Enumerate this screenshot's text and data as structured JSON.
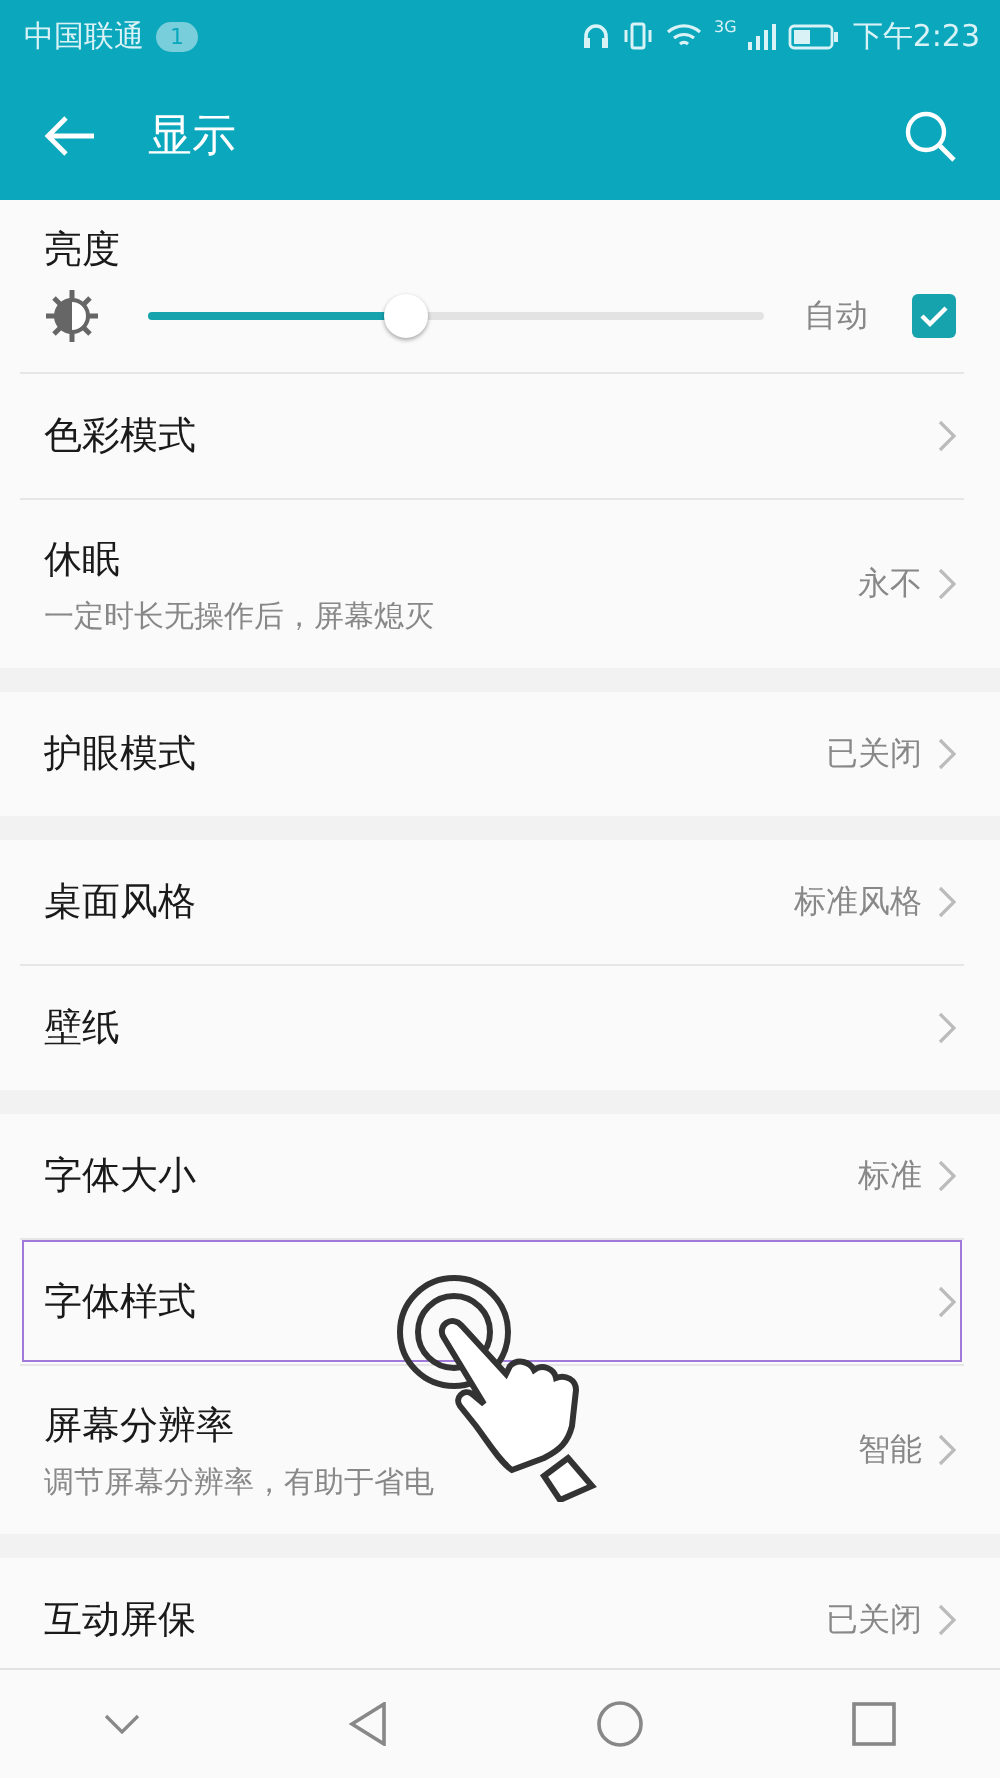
{
  "status_bar": {
    "carrier": "中国联通",
    "notification_count": "1",
    "network": "3G",
    "time": "下午2:23"
  },
  "app_bar": {
    "title": "显示"
  },
  "groups": [
    {
      "items": [
        {
          "kind": "slider",
          "title": "亮度",
          "level": 0.42,
          "auto_label": "自动",
          "auto_checked": true
        },
        {
          "kind": "link",
          "title": "色彩模式",
          "highlighted": false
        },
        {
          "kind": "link",
          "title": "休眠",
          "subtitle": "一定时长无操作后，屏幕熄灭",
          "value": "永不",
          "highlighted": false
        }
      ]
    },
    {
      "items": [
        {
          "kind": "link",
          "title": "护眼模式",
          "value": "已关闭",
          "highlighted": false
        }
      ]
    },
    {
      "items": [
        {
          "kind": "link",
          "title": "桌面风格",
          "value": "标准风格",
          "highlighted": false
        },
        {
          "kind": "link",
          "title": "壁纸",
          "highlighted": false
        }
      ]
    },
    {
      "items": [
        {
          "kind": "link",
          "title": "字体大小",
          "value": "标准",
          "highlighted": false
        },
        {
          "kind": "link",
          "title": "字体样式",
          "highlighted": true
        },
        {
          "kind": "link",
          "title": "屏幕分辨率",
          "subtitle": "调节屏幕分辨率，有助于省电",
          "value": "智能",
          "highlighted": false
        }
      ]
    },
    {
      "items": [
        {
          "kind": "link",
          "title": "互动屏保",
          "value": "已关闭",
          "highlighted": false
        }
      ]
    }
  ]
}
